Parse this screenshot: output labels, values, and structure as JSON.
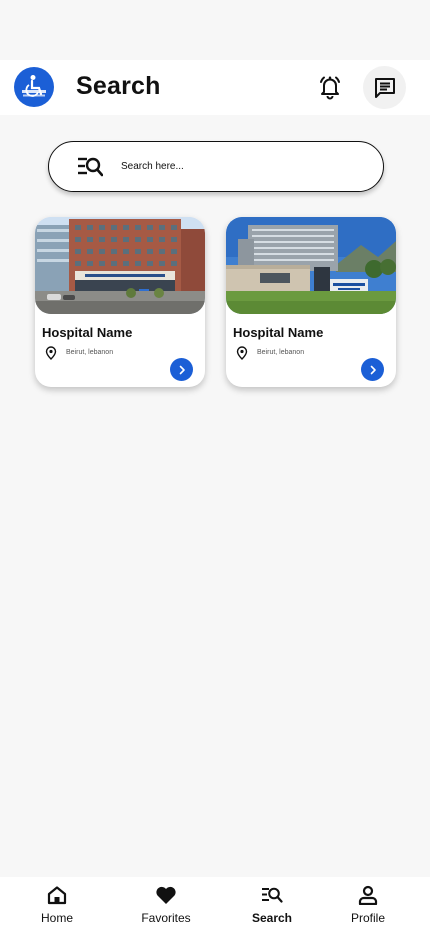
{
  "header": {
    "title": "Search"
  },
  "search": {
    "placeholder": "Search here..."
  },
  "hospitals": [
    {
      "name": "Hospital Name",
      "location": "Beirut, lebanon"
    },
    {
      "name": "Hospital Name",
      "location": "Beirut, lebanon"
    }
  ],
  "nav": {
    "items": [
      {
        "label": "Home",
        "icon": "home-icon"
      },
      {
        "label": "Favorites",
        "icon": "heart-icon"
      },
      {
        "label": "Search",
        "icon": "search-list-icon"
      },
      {
        "label": "Profile",
        "icon": "person-icon"
      }
    ],
    "active": "Search"
  },
  "colors": {
    "accent": "#1b5fd6",
    "background": "#f7f7f7"
  }
}
